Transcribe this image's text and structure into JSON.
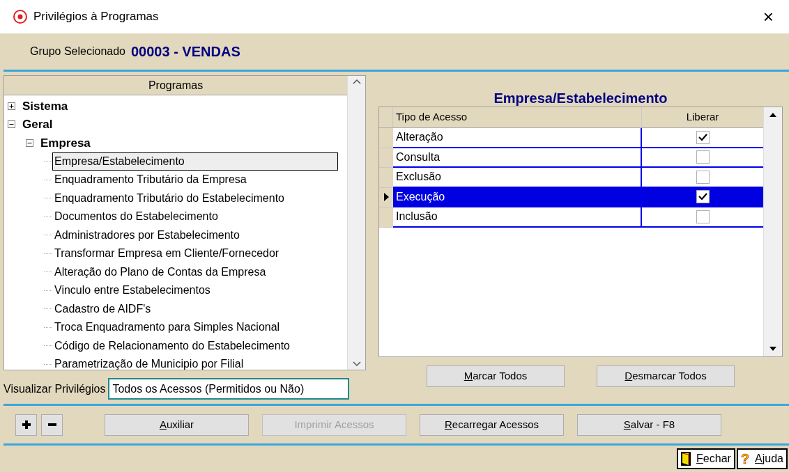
{
  "window": {
    "title": "Privilégios à Programas",
    "close": "×"
  },
  "group": {
    "label": "Grupo Selecionado",
    "value": "00003 - VENDAS"
  },
  "tree": {
    "header": "Programas",
    "items": [
      {
        "label": "Sistema",
        "kind": "folder",
        "expanded": false,
        "selected": false
      },
      {
        "label": "Geral",
        "kind": "folder",
        "expanded": true,
        "selected": false,
        "children": [
          {
            "label": "Empresa",
            "kind": "folder",
            "expanded": true,
            "selected": false,
            "children": [
              {
                "label": "Empresa/Estabelecimento",
                "selected": true
              },
              {
                "label": "Enquadramento Tributário da Empresa",
                "selected": false
              },
              {
                "label": "Enquadramento Tributário do Estabelecimento",
                "selected": false
              },
              {
                "label": "Documentos do Estabelecimento",
                "selected": false
              },
              {
                "label": "Administradores por Estabelecimento",
                "selected": false
              },
              {
                "label": "Transformar Empresa em Cliente/Fornecedor",
                "selected": false
              },
              {
                "label": "Alteração do Plano de Contas da Empresa",
                "selected": false
              },
              {
                "label": "Vinculo entre Estabelecimentos",
                "selected": false
              },
              {
                "label": "Cadastro de AIDF's",
                "selected": false
              },
              {
                "label": "Troca Enquadramento para Simples Nacional",
                "selected": false
              },
              {
                "label": "Código de Relacionamento do Estabelecimento",
                "selected": false
              },
              {
                "label": "Parametrização de Municipio por Filial",
                "selected": false
              }
            ]
          }
        ]
      }
    ]
  },
  "view_privileges": {
    "label": "Visualizar Privilégios",
    "value": "Todos os Acessos (Permitidos ou Não)"
  },
  "access_panel": {
    "title": "Empresa/Estabelecimento",
    "columns": [
      "Tipo de Acesso",
      "Liberar"
    ],
    "rows": [
      {
        "type": "Alteração",
        "checked": true,
        "selected": false
      },
      {
        "type": "Consulta",
        "checked": false,
        "selected": false
      },
      {
        "type": "Exclusão",
        "checked": false,
        "selected": false
      },
      {
        "type": "Execução",
        "checked": true,
        "selected": true
      },
      {
        "type": "Inclusão",
        "checked": false,
        "selected": false
      }
    ]
  },
  "grid_buttons": [
    {
      "label": "Marcar Todos",
      "mnemonic": true
    },
    {
      "label": "Desmarcar Todos",
      "mnemonic": true
    }
  ],
  "actions": [
    {
      "label": "Auxiliar",
      "disabled": false,
      "mnemonic": true
    },
    {
      "label": "Imprimir Acessos",
      "disabled": true,
      "mnemonic": false
    },
    {
      "label": "Recarregar Acessos",
      "disabled": false,
      "mnemonic": true
    },
    {
      "label": "Salvar - F8",
      "disabled": false,
      "mnemonic": true
    }
  ],
  "status_bar": [
    {
      "label": "Fechar",
      "kind": "close"
    },
    {
      "label": "Ajuda",
      "kind": "help",
      "icon": "?"
    }
  ]
}
